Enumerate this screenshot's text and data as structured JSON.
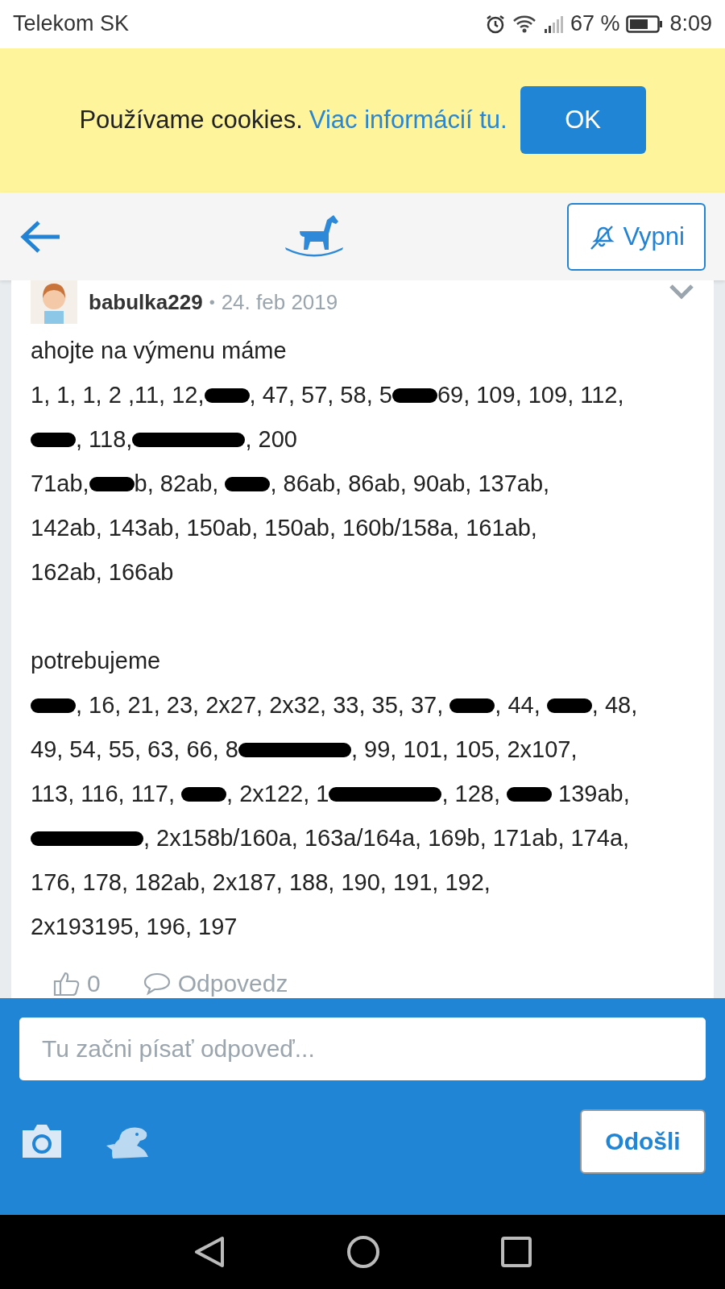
{
  "status_bar": {
    "carrier": "Telekom SK",
    "battery": "67 %",
    "time": "8:09"
  },
  "cookie_banner": {
    "text": "Používame cookies.",
    "link": "Viac informácií tu.",
    "button": "OK"
  },
  "header": {
    "mute_button": "Vypni"
  },
  "post": {
    "author": "babulka229",
    "separator": "•",
    "date": "24. feb 2019",
    "paragraphs": [
      [
        [
          {
            "kind": "text",
            "text": "ahojte na výmenu máme"
          }
        ],
        [
          {
            "kind": "text",
            "text": "1, 1, 1, 2 ,11, 12,"
          },
          {
            "kind": "redaction",
            "long": false
          },
          {
            "kind": "text",
            "text": ", 47, 57, 58, 5"
          },
          {
            "kind": "redaction",
            "long": false
          },
          {
            "kind": "text",
            "text": "69, 109, 109, 112,"
          }
        ],
        [
          {
            "kind": "redaction",
            "long": false
          },
          {
            "kind": "text",
            "text": ", 118,"
          },
          {
            "kind": "redaction",
            "long": true
          },
          {
            "kind": "text",
            "text": ", 200"
          }
        ],
        [
          {
            "kind": "text",
            "text": "71ab,"
          },
          {
            "kind": "redaction",
            "long": false
          },
          {
            "kind": "text",
            "text": "b, 82ab, "
          },
          {
            "kind": "redaction",
            "long": false
          },
          {
            "kind": "text",
            "text": ", 86ab, 86ab, 90ab, 137ab,"
          }
        ],
        [
          {
            "kind": "text",
            "text": "142ab, 143ab, 150ab, 150ab, 160b/158a, 161ab,"
          }
        ],
        [
          {
            "kind": "text",
            "text": "162ab, 166ab"
          }
        ]
      ],
      [
        [
          {
            "kind": "text",
            "text": "potrebujeme"
          }
        ],
        [
          {
            "kind": "redaction",
            "long": false
          },
          {
            "kind": "text",
            "text": ", 16, 21, 23, 2x27, 2x32, 33, 35, 37, "
          },
          {
            "kind": "redaction",
            "long": false
          },
          {
            "kind": "text",
            "text": ", 44, "
          },
          {
            "kind": "redaction",
            "long": false
          },
          {
            "kind": "text",
            "text": ", 48,"
          }
        ],
        [
          {
            "kind": "text",
            "text": "49, 54, 55, 63, 66, 8"
          },
          {
            "kind": "redaction",
            "long": true
          },
          {
            "kind": "text",
            "text": ", 99, 101, 105, 2x107,"
          }
        ],
        [
          {
            "kind": "text",
            "text": "113, 116, 117, "
          },
          {
            "kind": "redaction",
            "long": false
          },
          {
            "kind": "text",
            "text": ", 2x122, 1"
          },
          {
            "kind": "redaction",
            "long": true
          },
          {
            "kind": "text",
            "text": ", 128, "
          },
          {
            "kind": "redaction",
            "long": false
          },
          {
            "kind": "text",
            "text": " 139ab,"
          }
        ],
        [
          {
            "kind": "redaction",
            "long": true
          },
          {
            "kind": "text",
            "text": ", 2x158b/160a, 163a/164a, 169b, 171ab, 174a,"
          }
        ],
        [
          {
            "kind": "text",
            "text": "176, 178, 182ab, 2x187, 188, 190, 191, 192,"
          }
        ],
        [
          {
            "kind": "text",
            "text": "2x193195, 196, 197"
          }
        ]
      ]
    ],
    "likes": "0",
    "reply": "Odpovedz"
  },
  "composer": {
    "placeholder": "Tu začni písať odpoveď...",
    "send_button": "Odošli"
  }
}
